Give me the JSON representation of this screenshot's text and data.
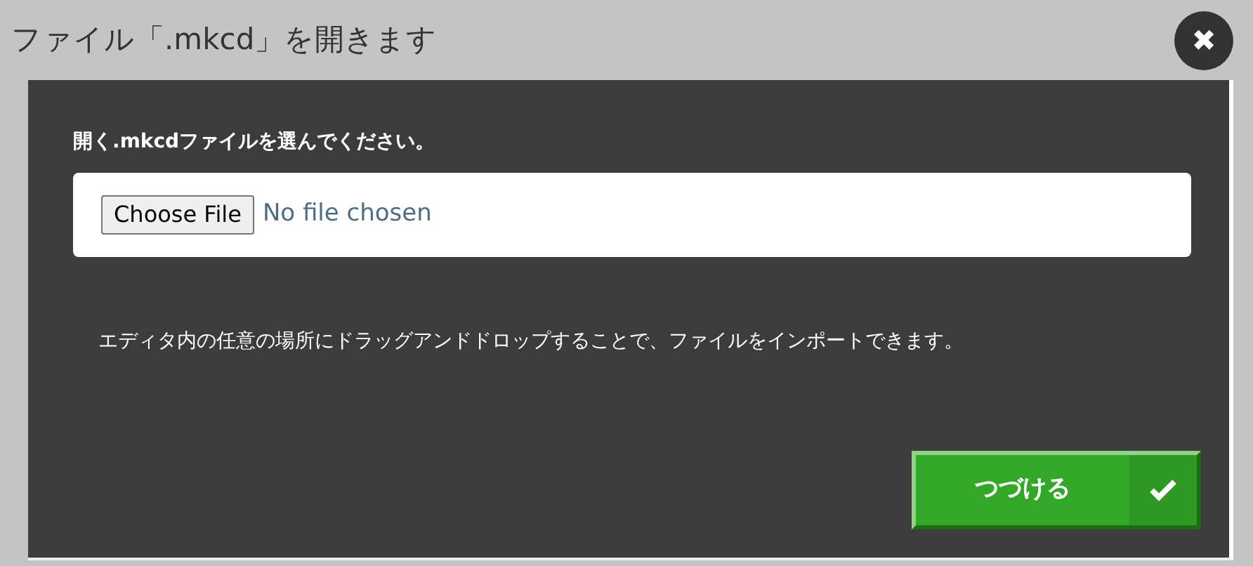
{
  "dialog": {
    "title": "ファイル「.mkcd」を開きます",
    "close_symbol": "✖"
  },
  "file_picker": {
    "label": "開く.mkcdファイルを選んでください。",
    "button": "Choose File",
    "status": "No file chosen"
  },
  "hint": "エディタ内の任意の場所にドラッグアンドドロップすることで、ファイルをインポートできます。",
  "confirm_button": {
    "label": "つづける"
  }
}
